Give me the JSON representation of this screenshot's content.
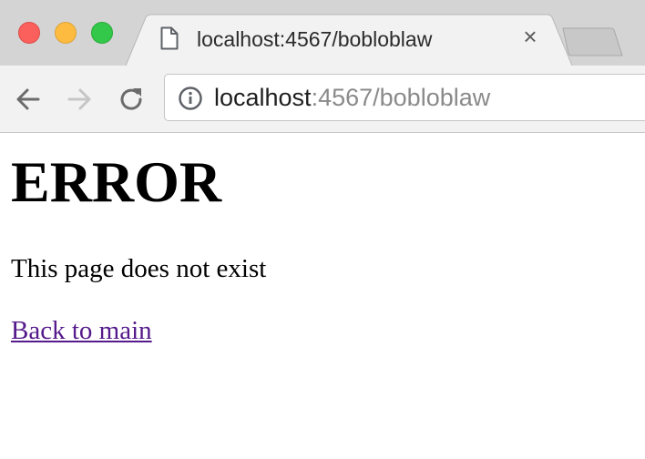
{
  "browser": {
    "tab": {
      "title": "localhost:4567/bobloblaw",
      "close_glyph": "×",
      "icon": "document-icon"
    },
    "address": {
      "host": "localhost",
      "rest": ":4567/bobloblaw",
      "icon": "info-icon"
    },
    "nav": {
      "back_icon": "arrow-left-icon",
      "forward_icon": "arrow-right-icon",
      "reload_icon": "reload-icon"
    },
    "window_controls": [
      "close",
      "minimize",
      "zoom"
    ],
    "colors": {
      "tabstrip": "#d4d4d4",
      "toolbar": "#f2f2f2",
      "url_host": "#1f1f1f",
      "url_rest": "#8a8a8a"
    }
  },
  "page": {
    "heading": "ERROR",
    "message": "This page does not exist",
    "link": "Back to main",
    "link_color": "#551a8b"
  }
}
